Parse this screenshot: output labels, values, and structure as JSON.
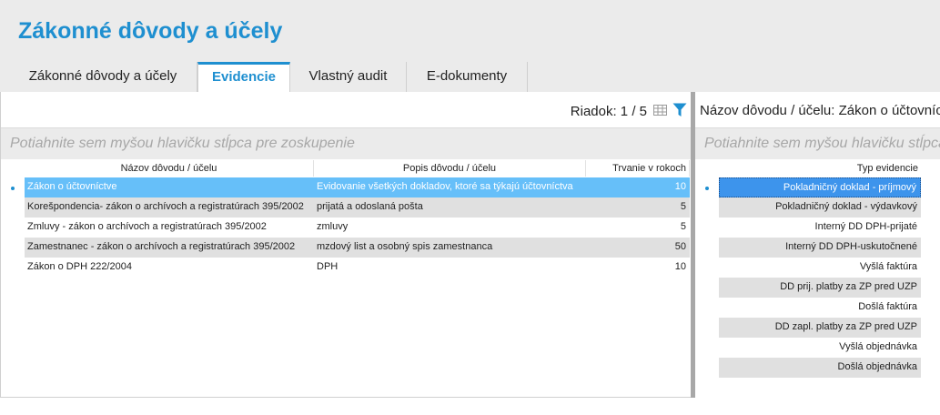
{
  "page": {
    "title": "Zákonné dôvody a účely"
  },
  "tabs": [
    {
      "label": "Zákonné dôvody a účely",
      "active": false
    },
    {
      "label": "Evidencie",
      "active": true
    },
    {
      "label": "Vlastný audit",
      "active": false
    },
    {
      "label": "E-dokumenty",
      "active": false
    }
  ],
  "left_grid": {
    "row_counter": "Riadok: 1 / 5",
    "group_hint": "Potiahnite sem myšou hlavičku stĺpca pre zoskupenie",
    "columns": [
      "Názov dôvodu / účelu",
      "Popis dôvodu / účelu",
      "Trvanie v rokoch"
    ],
    "rows": [
      {
        "name": "Zákon o účtovníctve",
        "desc": "Evidovanie všetkých dokladov, ktoré sa týkajú účtovníctva",
        "years": "10"
      },
      {
        "name": "Korešpondencia- zákon o archívoch a registratúrach 395/2002",
        "desc": "prijatá a odoslaná pošta",
        "years": "5"
      },
      {
        "name": "Zmluvy - zákon o archívoch a registratúrach 395/2002",
        "desc": "zmluvy",
        "years": "5"
      },
      {
        "name": "Zamestnanec - zákon o archívoch a registratúrach 395/2002",
        "desc": "mzdový list a osobný spis zamestnanca",
        "years": "50"
      },
      {
        "name": "Zákon o DPH 222/2004",
        "desc": "DPH",
        "years": "10"
      }
    ]
  },
  "right_grid": {
    "filter_label": "Názov dôvodu / účelu: Zákon o účtovníctve",
    "group_hint": "Potiahnite sem myšou hlavičku stĺpca pre zoskupenie",
    "column": "Typ evidencie",
    "rows": [
      "Pokladničný doklad - príjmový",
      "Pokladničný doklad - výdavkový",
      "Interný DD DPH-prijaté",
      "Interný DD DPH-uskutočnené",
      "Vyšlá faktúra",
      "DD prij. platby za ZP pred UZP",
      "Došlá faktúra",
      "DD zapl. platby za ZP pred UZP",
      "Vyšlá objednávka",
      "Došlá objednávka"
    ]
  },
  "colors": {
    "accent": "#1e8fd0",
    "selected_row": "#66bff9",
    "selected_row_right": "#3d94ec",
    "alt_row": "#e0e0e0"
  },
  "icons": {
    "grid": "grid-icon",
    "filter": "filter-icon"
  }
}
